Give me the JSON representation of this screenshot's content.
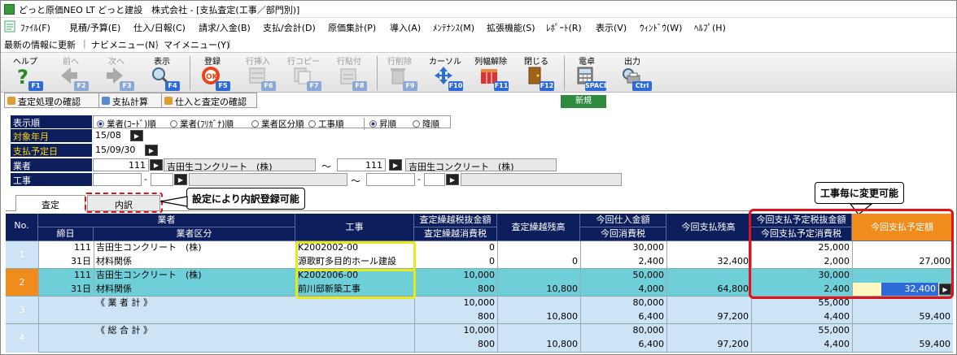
{
  "window": {
    "title": "どっと原価NEO LT どっと建設　株式会社 - [支払査定(工事／部門別)]"
  },
  "menu": [
    {
      "label": "ﾌｧｲﾙ(F)"
    },
    {
      "label": "見積/予算(E)"
    },
    {
      "label": "仕入/日報(C)"
    },
    {
      "label": "請求/入金(B)"
    },
    {
      "label": "支払/会計(D)"
    },
    {
      "label": "原価集計(P)"
    },
    {
      "label": "導入(A)"
    },
    {
      "label": "ﾒﾝﾃﾅﾝｽ(M)"
    },
    {
      "label": "拡張機能(S)"
    },
    {
      "label": "ﾚﾎﾟｰﾄ(R)"
    },
    {
      "label": "表示(V)"
    },
    {
      "label": "ｳｨﾝﾄﾞｳ(W)"
    },
    {
      "label": "ﾍﾙﾌﾟ(H)"
    }
  ],
  "quick": {
    "refresh": "最新の情報に更新",
    "nav": "ナビメニュー(N)",
    "my": "マイメニュー(Y)",
    "sep": "|"
  },
  "toolbar": [
    {
      "label": "ヘルプ",
      "key": "F1",
      "icon": "help-icon",
      "enabled": true
    },
    {
      "label": "前へ",
      "key": "F2",
      "icon": "arrow-left-icon",
      "enabled": false
    },
    {
      "label": "次へ",
      "key": "F3",
      "icon": "arrow-right-icon",
      "enabled": false
    },
    {
      "label": "表示",
      "key": "F4",
      "icon": "magnifier-icon",
      "enabled": true
    },
    {
      "label": "登録",
      "key": "F5",
      "icon": "ok-icon",
      "enabled": true
    },
    {
      "label": "行挿入",
      "key": "F6",
      "icon": "row-insert-icon",
      "enabled": false
    },
    {
      "label": "行コピー",
      "key": "F7",
      "icon": "row-copy-icon",
      "enabled": false
    },
    {
      "label": "行貼付",
      "key": "F8",
      "icon": "row-paste-icon",
      "enabled": false
    },
    {
      "label": "行削除",
      "key": "F9",
      "icon": "row-delete-icon",
      "enabled": false
    },
    {
      "label": "カーソル",
      "key": "F10",
      "icon": "cursor-icon",
      "enabled": true
    },
    {
      "label": "列幅解除",
      "key": "F11",
      "icon": "column-width-icon",
      "enabled": true
    },
    {
      "label": "閉じる",
      "key": "F12",
      "icon": "door-icon",
      "enabled": true
    },
    {
      "label": "電卓",
      "key": "SPACE",
      "icon": "calculator-icon",
      "enabled": true
    },
    {
      "label": "出力",
      "key": "Ctrl P",
      "icon": "print-icon",
      "enabled": true
    }
  ],
  "subtoolbar": {
    "check": "査定処理の確認",
    "calc": "支払計算",
    "confirm": "仕入と査定の確認",
    "new": "新規"
  },
  "form": {
    "order_label": "表示順",
    "order_options": [
      "業者(ｺｰﾄﾞ)順",
      "業者(ﾌﾘｶﾞﾅ)順",
      "業者区分順",
      "工事順"
    ],
    "sort_options": [
      "昇順",
      "降順"
    ],
    "year_label": "対象年月",
    "year_value": "15/08",
    "paydate_label": "支払予定日",
    "paydate_value": "15/09/30",
    "vendor_label": "業者",
    "vendor_from_code": "111",
    "vendor_from_name": "吉田生コンクリート　(株)",
    "range_sep": "～",
    "vendor_to_code": "111",
    "vendor_to_name": "吉田生コンクリート　(株)",
    "project_label": "工事",
    "dash": "-"
  },
  "tabs": [
    "査定",
    "内訳"
  ],
  "callouts": {
    "left": "設定により内訳登録可能",
    "right": "工事毎に変更可能"
  },
  "grid": {
    "headers": {
      "no": "No.",
      "vendor": "業者",
      "close": "締日",
      "vendor_cat": "業者区分",
      "project": "工事",
      "c1a": "査定繰越税抜金額",
      "c1b": "査定繰越消費税",
      "c2": "査定繰越残高",
      "c3a": "今回仕入金額",
      "c3b": "今回消費税",
      "c4": "今回支払残高",
      "c5a": "今回支払予定税抜金額",
      "c5b": "今回支払予定消費税",
      "c6": "今回支払予定額"
    },
    "rows": [
      {
        "no": "1",
        "code": "111",
        "name": "吉田生コンクリート　(株)",
        "close": "31日",
        "cat": "材料関係",
        "proj_code": "K2002002-00",
        "proj_name": "源歌町多目的ホール建設",
        "c1a": "0",
        "c1b": "0",
        "c2": "0",
        "c3a": "30,000",
        "c3b": "2,400",
        "c4": "32,400",
        "c5a": "25,000",
        "c5b": "2,000",
        "c6": "27,000"
      },
      {
        "no": "2",
        "code": "111",
        "name": "吉田生コンクリート　(株)",
        "close": "31日",
        "cat": "材料関係",
        "proj_code": "K2002006-00",
        "proj_name": "前川邸新築工事",
        "c1a": "10,000",
        "c1b": "800",
        "c2": "10,800",
        "c3a": "50,000",
        "c3b": "4,000",
        "c4": "64,800",
        "c5a": "30,000",
        "c5b": "2,400",
        "c6": "32,400"
      },
      {
        "no": "3",
        "label": "《 業 者 計 》",
        "c1a": "10,000",
        "c1b": "800",
        "c2": "10,800",
        "c3a": "80,000",
        "c3b": "6,400",
        "c4": "97,200",
        "c5a": "55,000",
        "c5b": "4,400",
        "c6": "59,400"
      },
      {
        "no": "4",
        "label": "《 総 合 計 》",
        "c1a": "10,000",
        "c1b": "800",
        "c2": "10,800",
        "c3a": "80,000",
        "c3b": "6,400",
        "c4": "97,200",
        "c5a": "55,000",
        "c5b": "4,400",
        "c6": "59,400"
      }
    ]
  },
  "colors": {
    "header": "#0c1f5c",
    "selected_row": "#6fcfd8",
    "total_row": "#cde4f7",
    "orange": "#f08c1c",
    "highlight_red": "#e0121c",
    "highlight_yellow": "#e8e81a"
  }
}
